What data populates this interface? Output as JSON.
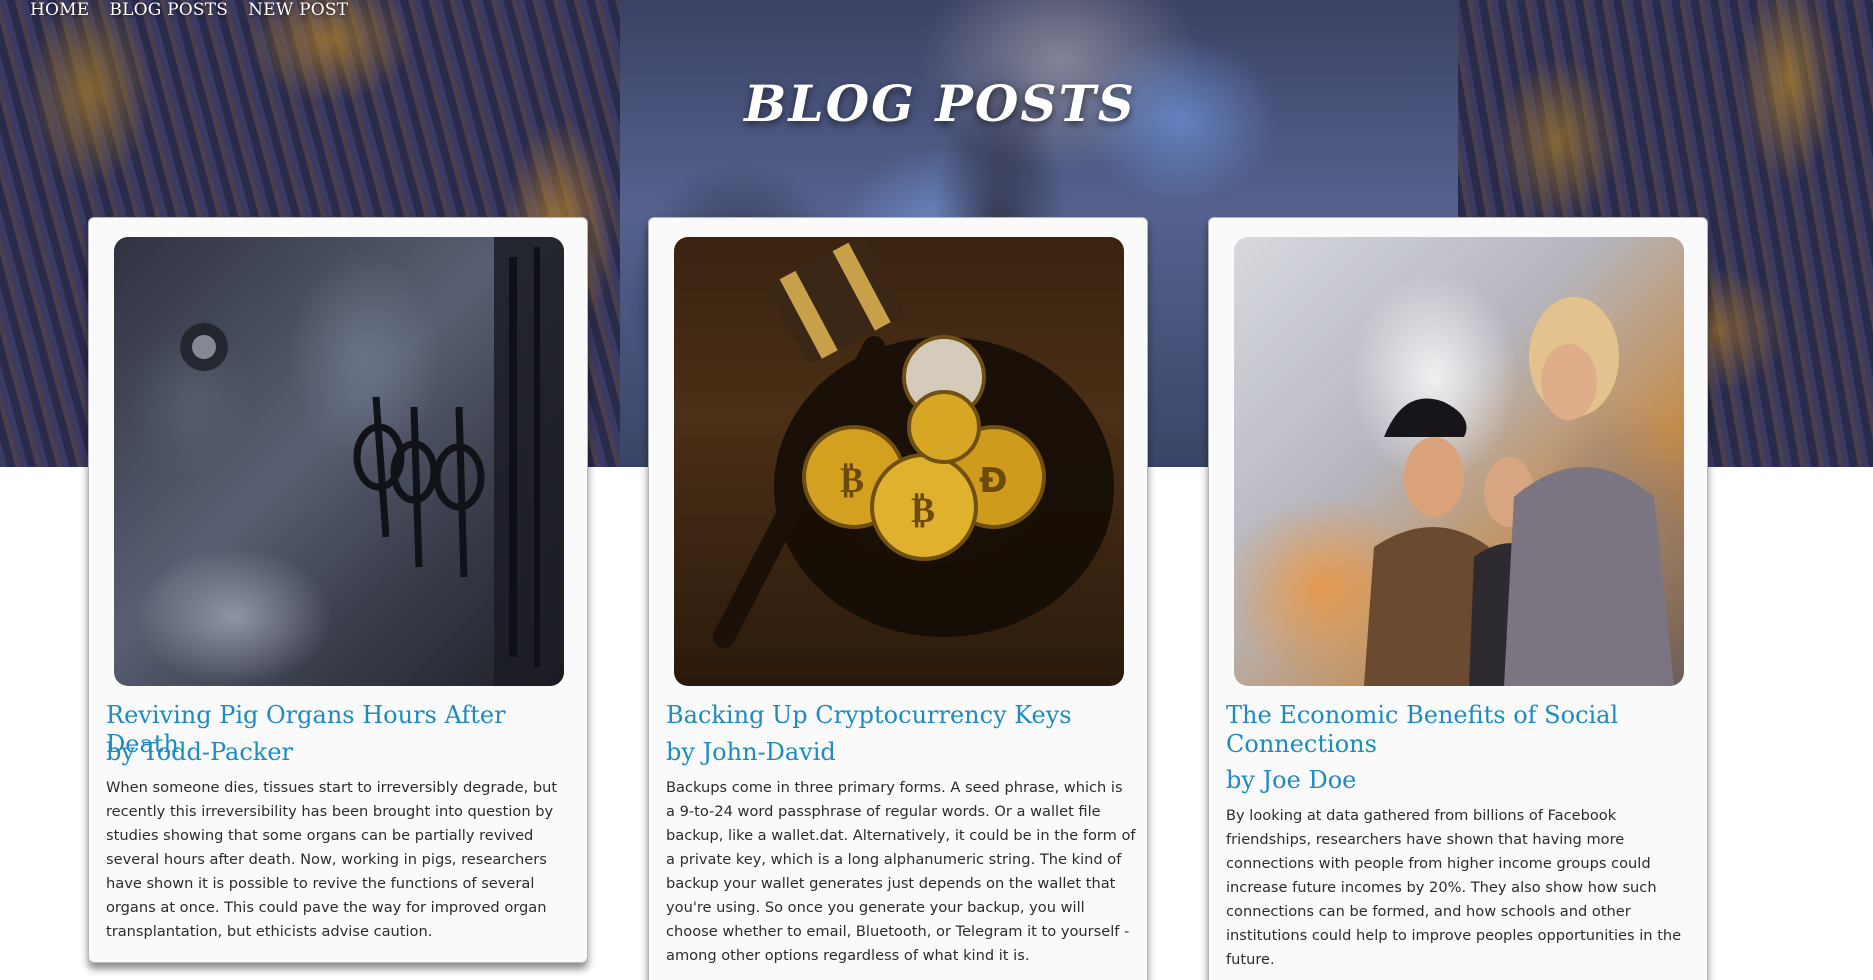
{
  "nav": {
    "home": "HOME",
    "blog_posts": "BLOG POSTS",
    "new_post": "NEW POST"
  },
  "page": {
    "title": "BLOG POSTS"
  },
  "posts": [
    {
      "title": "Reviving Pig Organs Hours After Death",
      "author": "by Todd-Packer",
      "body": "When someone dies, tissues start to irreversibly degrade, but recently this irreversibility has been brought into question by studies showing that some organs can be partially revived several hours after death. Now, working in pigs, researchers have shown it is possible to revive the functions of several organs at once. This could pave the way for improved organ transplantation, but ethicists advise caution."
    },
    {
      "title": "Backing Up Cryptocurrency Keys",
      "author": "by John-David",
      "body": "Backups come in three primary forms. A seed phrase, which is a 9-to-24 word passphrase of regular words. Or a wallet file backup, like a wallet.dat. Alternatively, it could be in the form of a private key, which is a long alphanumeric string. The kind of backup your wallet generates just depends on the wallet that you're using. So once you generate your backup, you will choose whether to email, Bluetooth, or Telegram it to yourself - among other options regardless of what kind it is."
    },
    {
      "title": "The Economic Benefits of Social Connections",
      "author": "by Joe Doe",
      "body": "By looking at data gathered from billions of Facebook friendships, researchers have shown that having more connections with people from higher income groups could increase future incomes by 20%. They also show how such connections can be formed, and how schools and other institutions could help to improve peoples opportunities in the future."
    }
  ],
  "colors": {
    "link_blue": "#1c8bc0",
    "body_text": "#2c2c2c",
    "card_bg": "#fafafa"
  }
}
